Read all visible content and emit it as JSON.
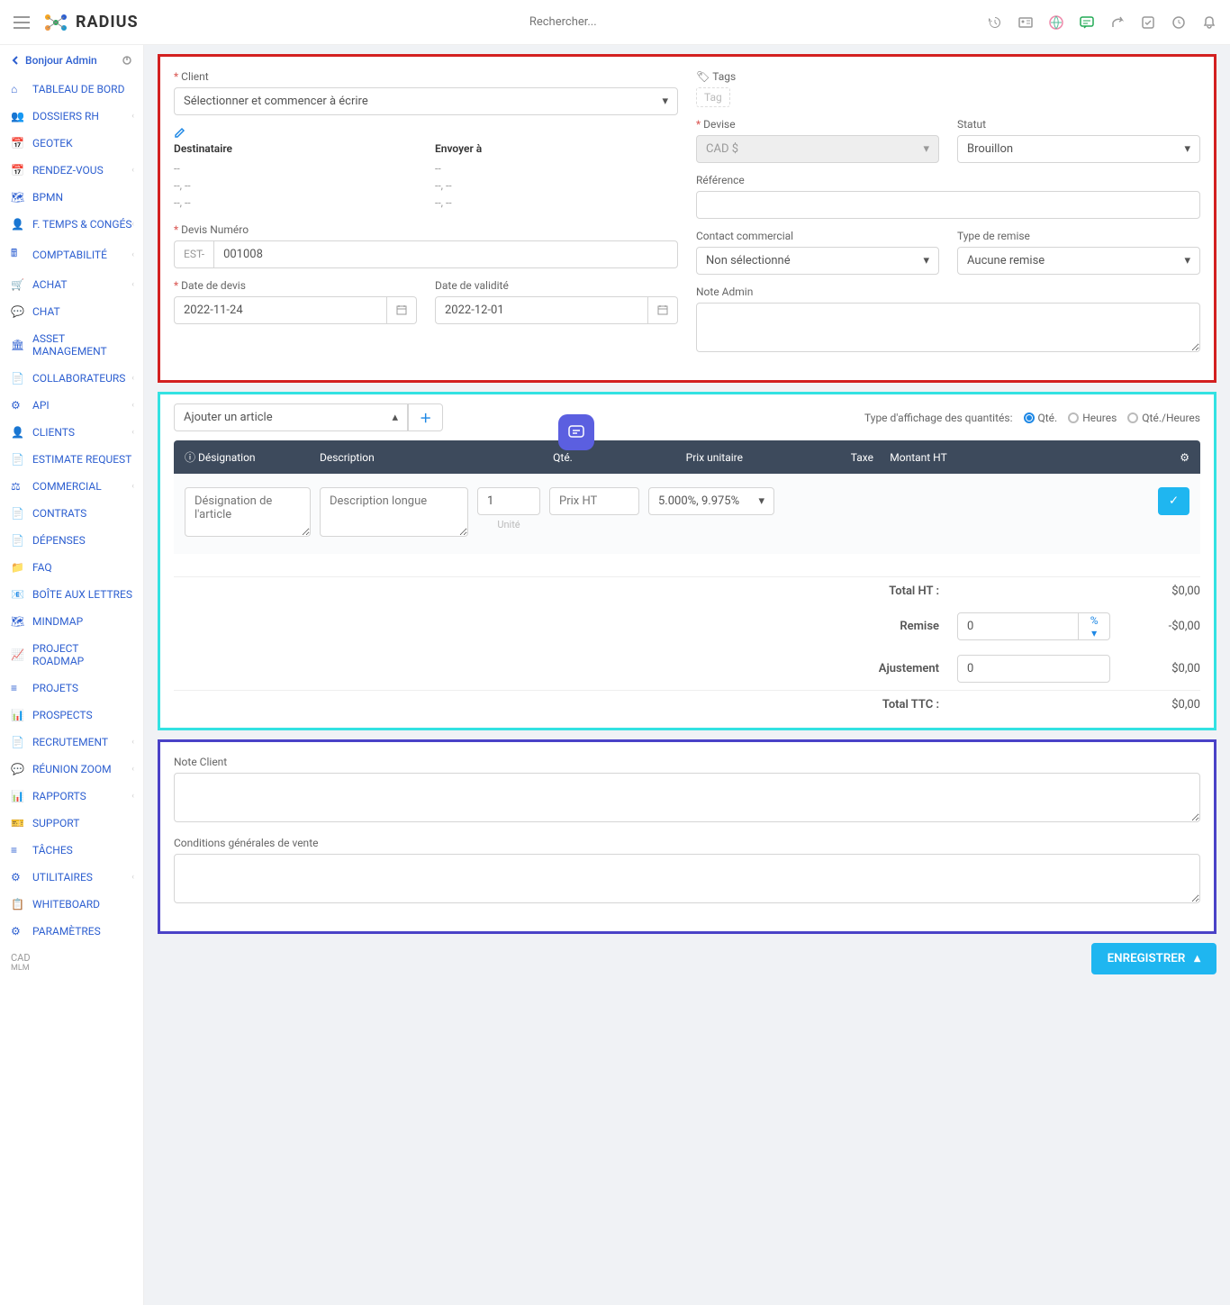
{
  "app_name": "RADIUS",
  "search_placeholder": "Rechercher...",
  "greeting": "Bonjour Admin",
  "nav": [
    {
      "label": "TABLEAU DE BORD",
      "expand": false
    },
    {
      "label": "DOSSIERS RH",
      "expand": true
    },
    {
      "label": "GEOTEK",
      "expand": false
    },
    {
      "label": "RENDEZ-VOUS",
      "expand": true
    },
    {
      "label": "BPMN",
      "expand": false
    },
    {
      "label": "F. TEMPS & CONGÉS",
      "expand": true
    },
    {
      "label": "COMPTABILITÉ",
      "expand": true
    },
    {
      "label": "ACHAT",
      "expand": true
    },
    {
      "label": "CHAT",
      "expand": false
    },
    {
      "label": "ASSET MANAGEMENT",
      "expand": false
    },
    {
      "label": "COLLABORATEURS",
      "expand": true
    },
    {
      "label": "API",
      "expand": true
    },
    {
      "label": "CLIENTS",
      "expand": true
    },
    {
      "label": "ESTIMATE REQUEST",
      "expand": false
    },
    {
      "label": "COMMERCIAL",
      "expand": true
    },
    {
      "label": "CONTRATS",
      "expand": false
    },
    {
      "label": "DÉPENSES",
      "expand": false
    },
    {
      "label": "FAQ",
      "expand": false
    },
    {
      "label": "BOÎTE AUX LETTRES",
      "expand": false
    },
    {
      "label": "MINDMAP",
      "expand": false
    },
    {
      "label": "PROJECT ROADMAP",
      "expand": false
    },
    {
      "label": "PROJETS",
      "expand": false
    },
    {
      "label": "PROSPECTS",
      "expand": false
    },
    {
      "label": "RECRUTEMENT",
      "expand": true
    },
    {
      "label": "RÉUNION ZOOM",
      "expand": true
    },
    {
      "label": "RAPPORTS",
      "expand": true
    },
    {
      "label": "SUPPORT",
      "expand": false
    },
    {
      "label": "TÂCHES",
      "expand": false
    },
    {
      "label": "UTILITAIRES",
      "expand": true
    },
    {
      "label": "WHITEBOARD",
      "expand": false
    },
    {
      "label": "PARAMÈTRES",
      "expand": false
    }
  ],
  "footer": {
    "currency": "CAD",
    "code": "MLM"
  },
  "form": {
    "client_label": "Client",
    "client_placeholder": "Sélectionner et commencer à écrire",
    "dest_label": "Destinataire",
    "send_label": "Envoyer à",
    "dash_lines": [
      "--",
      "--, --",
      "--, --"
    ],
    "devis_label": "Devis Numéro",
    "devis_prefix": "EST-",
    "devis_value": "001008",
    "date_devis_label": "Date de devis",
    "date_devis_value": "2022-11-24",
    "date_valid_label": "Date de validité",
    "date_valid_value": "2022-12-01",
    "tags_label": "Tags",
    "tag_placeholder": "Tag",
    "devise_label": "Devise",
    "devise_value": "CAD $",
    "status_label": "Statut",
    "status_value": "Brouillon",
    "ref_label": "Référence",
    "contact_label": "Contact commercial",
    "contact_value": "Non sélectionné",
    "discount_type_label": "Type de remise",
    "discount_type_value": "Aucune remise",
    "note_admin_label": "Note Admin"
  },
  "items": {
    "add_placeholder": "Ajouter un article",
    "qty_display_label": "Type d'affichage des quantités:",
    "opt_qty": "Qté.",
    "opt_hours": "Heures",
    "opt_qty_hours": "Qté./Heures",
    "head": {
      "des": "Désignation",
      "desc": "Description",
      "qty": "Qté.",
      "pu": "Prix unitaire",
      "tax": "Taxe",
      "amt": "Montant HT"
    },
    "row": {
      "des_ph": "Désignation de l'article",
      "desc_ph": "Description longue",
      "qty": "1",
      "pu_ph": "Prix HT",
      "tax": "5.000%, 9.975%",
      "unit": "Unité"
    },
    "totals": {
      "subtotal_label": "Total HT :",
      "subtotal": "$0,00",
      "discount_label": "Remise",
      "discount_val": "0",
      "discount_amt": "-$0,00",
      "pct": "%",
      "adjust_label": "Ajustement",
      "adjust_val": "0",
      "adjust_amt": "$0,00",
      "total_label": "Total TTC :",
      "total": "$0,00"
    }
  },
  "notes": {
    "client_label": "Note Client",
    "terms_label": "Conditions générales de vente"
  },
  "save_label": "ENREGISTRER"
}
